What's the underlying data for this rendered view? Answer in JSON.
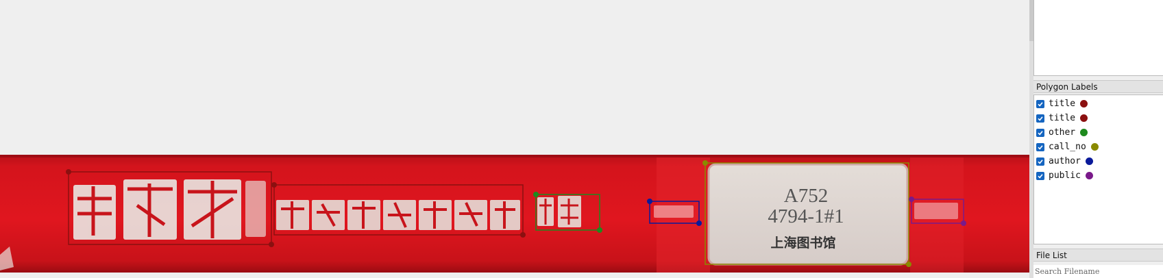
{
  "colors": {
    "title": "#8b1010",
    "other": "#1e8a1e",
    "call_no": "#8a8a00",
    "author": "#0a1a9a",
    "public": "#7a1a8a"
  },
  "image": {
    "call_label_line1": "A752",
    "call_label_line2": "4794-1#1",
    "call_label_line3": "上海图书馆"
  },
  "polygon_labels": {
    "header": "Polygon Labels",
    "items": [
      {
        "label": "title",
        "color": "#8b1010",
        "checked": true
      },
      {
        "label": "title",
        "color": "#8b1010",
        "checked": true
      },
      {
        "label": "other",
        "color": "#1e8a1e",
        "checked": true
      },
      {
        "label": "call_no",
        "color": "#8a8a00",
        "checked": true
      },
      {
        "label": "author",
        "color": "#0a1a9a",
        "checked": true
      },
      {
        "label": "public",
        "color": "#7a1a8a",
        "checked": true
      }
    ]
  },
  "file_list": {
    "header": "File List",
    "search_placeholder": "Search Filename"
  }
}
